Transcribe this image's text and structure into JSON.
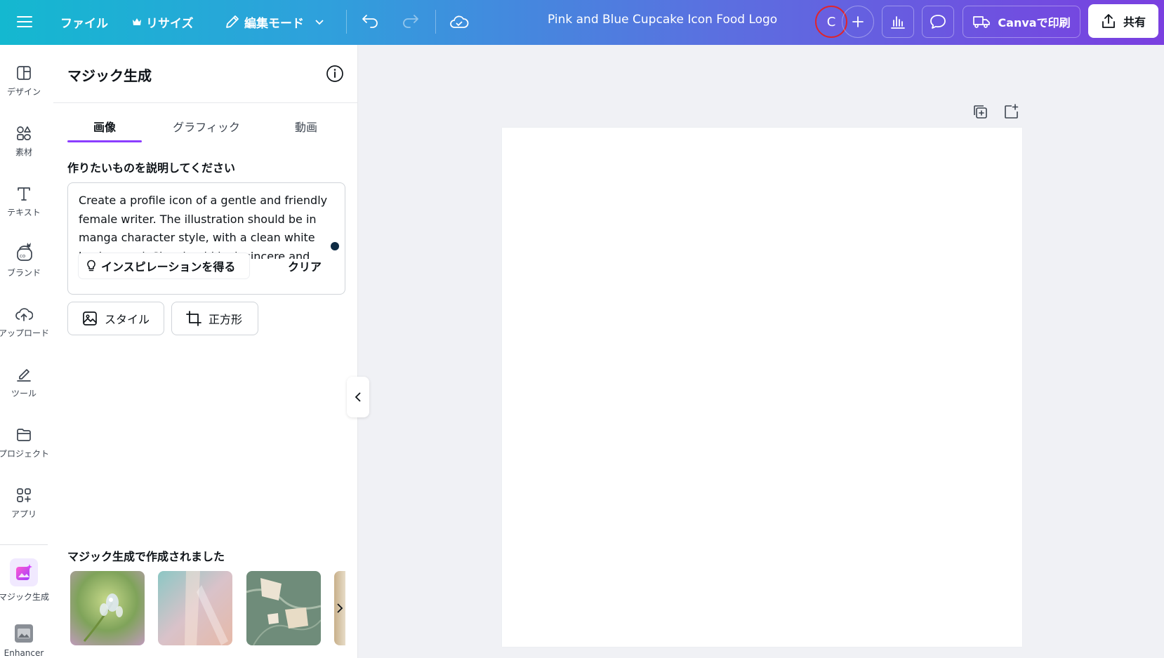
{
  "topbar": {
    "file_label": "ファイル",
    "resize_label": "リサイズ",
    "edit_mode_label": "編集モード",
    "doc_title": "Pink and Blue Cupcake Icon Food Logo",
    "avatar_letter": "C",
    "print_label": "Canvaで印刷",
    "share_label": "共有",
    "gradient": [
      "#14b8d0",
      "#7a3fe0"
    ]
  },
  "rail": {
    "items": [
      {
        "label": "デザイン",
        "icon": "design-icon"
      },
      {
        "label": "素材",
        "icon": "elements-icon"
      },
      {
        "label": "テキスト",
        "icon": "text-icon"
      },
      {
        "label": "ブランド",
        "icon": "brand-icon"
      },
      {
        "label": "アップロード",
        "icon": "upload-icon"
      },
      {
        "label": "ツール",
        "icon": "tools-icon"
      },
      {
        "label": "プロジェクト",
        "icon": "folder-icon"
      },
      {
        "label": "アプリ",
        "icon": "apps-icon"
      },
      {
        "label": "マジック生成",
        "icon": "magic-media-icon"
      },
      {
        "label": "Enhancer",
        "icon": "enhancer-icon"
      }
    ]
  },
  "panel": {
    "title": "マジック生成",
    "tabs": [
      {
        "label": "画像",
        "active": true
      },
      {
        "label": "グラフィック",
        "active": false
      },
      {
        "label": "動画",
        "active": false
      }
    ],
    "prompt_label": "作りたいものを説明してください",
    "prompt_text": "Create a profile icon of a gentle and friendly female writer. The illustration should be in manga character style, with a clean white background. She should look sincere and",
    "inspiration_label": "インスピレーションを得る",
    "clear_label": "クリア",
    "style_label": "スタイル",
    "aspect_label": "正方形",
    "created_label": "マジック生成で作成されました",
    "accent_color": "#8b3dff"
  }
}
